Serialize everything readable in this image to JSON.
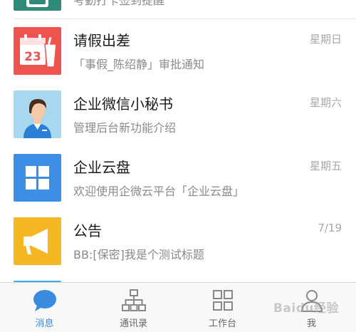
{
  "messages": [
    {
      "title": "",
      "subtitle": "考勤打卡签到提醒",
      "time": "",
      "icon": "attendance-icon",
      "color": "#2f8a7a"
    },
    {
      "title": "请假出差",
      "subtitle": "「事假_陈绍静」审批通知",
      "time": "星期日",
      "icon": "calendar-icon",
      "color": "#ef5350"
    },
    {
      "title": "企业微信小秘书",
      "subtitle": "管理后台新功能介绍",
      "time": "星期六",
      "icon": "assistant-avatar-icon",
      "color": "#a8d8f0"
    },
    {
      "title": "企业云盘",
      "subtitle": "欢迎使用企微云平台「企业云盘」",
      "time": "星期五",
      "icon": "grid-icon",
      "color": "#3d8fe5"
    },
    {
      "title": "公告",
      "subtitle": "BB:[保密]我是个测试标题",
      "time": "7/19",
      "icon": "megaphone-icon",
      "color": "#f5b824"
    },
    {
      "title": "",
      "subtitle": "",
      "time": "",
      "icon": "partial-icon",
      "color": "#3aaee8"
    }
  ],
  "tabs": [
    {
      "label": "消息",
      "icon": "chat-bubble-icon",
      "active": true
    },
    {
      "label": "通讯录",
      "icon": "org-chart-icon",
      "active": false
    },
    {
      "label": "工作台",
      "icon": "grid-icon",
      "active": false
    },
    {
      "label": "我",
      "icon": "person-icon",
      "active": false
    }
  ],
  "colors": {
    "accent": "#3a8be0",
    "tab_inactive": "#888888"
  },
  "watermark": "Baidu经验"
}
